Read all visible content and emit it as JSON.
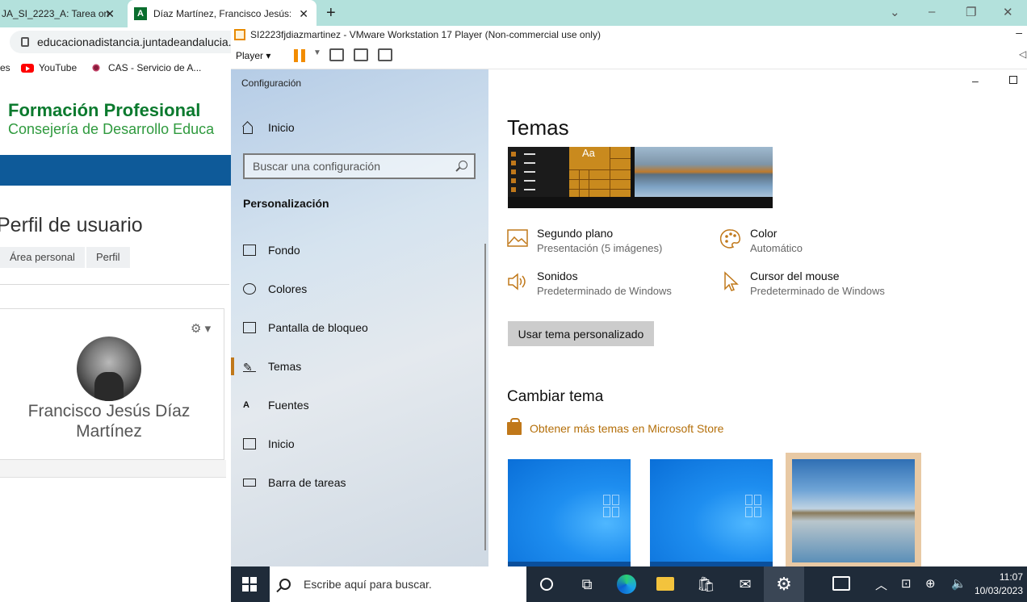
{
  "browser": {
    "tabs": [
      {
        "title": "JA_SI_2223_A: Tarea on",
        "active": false
      },
      {
        "title": "Díaz Martínez, Francisco Jesús: Pe",
        "active": true
      }
    ],
    "address": "educacionadistancia.juntadeandalucia.",
    "bookmarks": [
      {
        "label": "es"
      },
      {
        "label": "YouTube"
      },
      {
        "label": "CAS - Servicio de A..."
      }
    ]
  },
  "moodle": {
    "brand_line1": "Formación Profesional",
    "brand_line2": "Consejería de Desarrollo Educa",
    "page_title": "Perfil de usuario",
    "breadcrumb": [
      "Área personal",
      "Perfil"
    ],
    "user_name": "Francisco Jesús Díaz Martínez"
  },
  "vmware": {
    "title": "SI2223fjdiazmartinez - VMware Workstation 17 Player (Non-commercial use only)",
    "player_menu": "Player"
  },
  "settings": {
    "window_title": "Configuración",
    "home_label": "Inicio",
    "search_placeholder": "Buscar una configuración",
    "section": "Personalización",
    "nav": [
      {
        "label": "Fondo",
        "icon": "image-icon"
      },
      {
        "label": "Colores",
        "icon": "palette-icon"
      },
      {
        "label": "Pantalla de bloqueo",
        "icon": "lock-screen-icon"
      },
      {
        "label": "Temas",
        "icon": "brush-icon",
        "active": true
      },
      {
        "label": "Fuentes",
        "icon": "font-icon"
      },
      {
        "label": "Inicio",
        "icon": "start-icon"
      },
      {
        "label": "Barra de tareas",
        "icon": "taskbar-icon"
      }
    ],
    "page_title": "Temas",
    "preview_tile_text": "Aa",
    "props": [
      {
        "label": "Segundo plano",
        "value": "Presentación (5 imágenes)",
        "icon": "picture-icon"
      },
      {
        "label": "Color",
        "value": "Automático",
        "icon": "palette-icon"
      },
      {
        "label": "Sonidos",
        "value": "Predeterminado de Windows",
        "icon": "speaker-icon"
      },
      {
        "label": "Cursor del mouse",
        "value": "Predeterminado de Windows",
        "icon": "cursor-icon"
      }
    ],
    "use_custom_button": "Usar tema personalizado",
    "change_theme_title": "Cambiar tema",
    "store_link": "Obtener más temas en Microsoft Store",
    "accent_color": "#c0781a"
  },
  "taskbar": {
    "search_placeholder": "Escribe aquí para buscar.",
    "time": "11:07",
    "date": "10/03/2023"
  }
}
